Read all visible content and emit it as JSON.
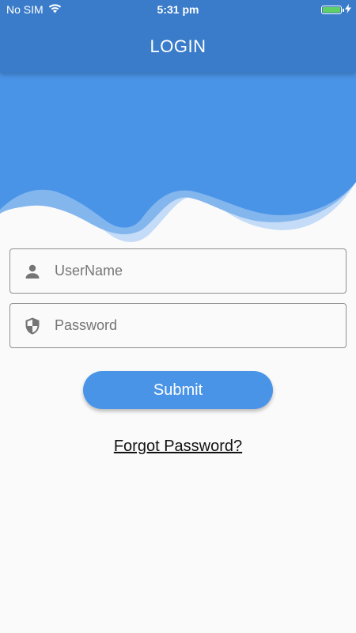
{
  "status_bar": {
    "carrier": "No SIM",
    "time": "5:31 pm",
    "battery_level": 1.0,
    "charging": true
  },
  "app_bar": {
    "title": "LOGIN"
  },
  "form": {
    "username": {
      "placeholder": "UserName",
      "value": "",
      "icon": "person-icon"
    },
    "password": {
      "placeholder": "Password",
      "value": "",
      "icon": "shield-icon"
    },
    "submit_label": "Submit",
    "forgot_label": "Forgot Password?"
  },
  "colors": {
    "app_bar": "#3a7cc9",
    "wave_primary": "#4a94e8",
    "wave_light": "#c4dcf7",
    "button": "#4a94e8",
    "background": "#fafafa"
  }
}
